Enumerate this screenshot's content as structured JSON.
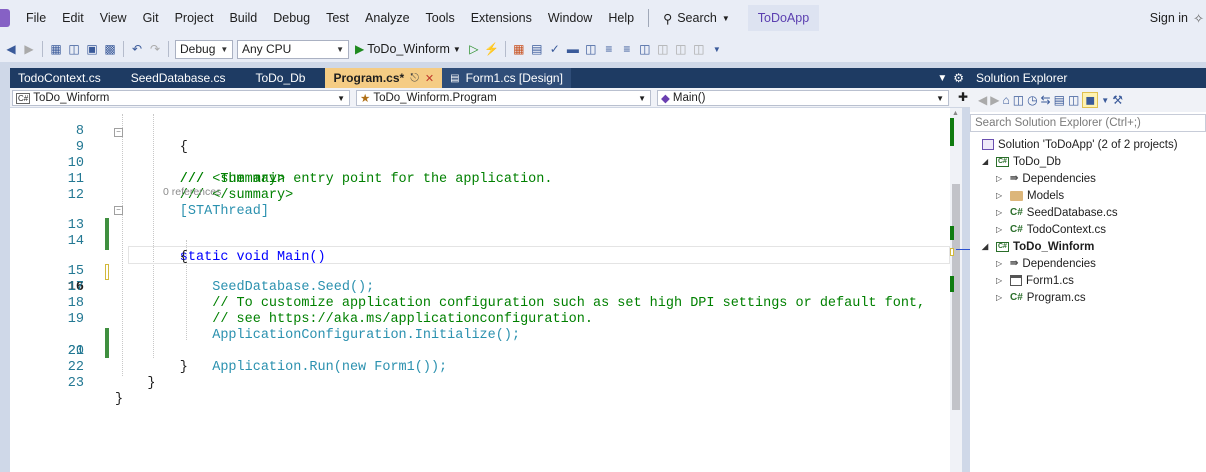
{
  "menubar": {
    "items": [
      "File",
      "Edit",
      "View",
      "Git",
      "Project",
      "Build",
      "Debug",
      "Test",
      "Analyze",
      "Tools",
      "Extensions",
      "Window",
      "Help"
    ],
    "search_label": "Search",
    "app_name": "ToDoApp",
    "sign_in": "Sign in"
  },
  "toolbar": {
    "config": "Debug",
    "platform": "Any CPU",
    "run_target": "ToDo_Winform"
  },
  "tabs": [
    {
      "label": "TodoContext.cs"
    },
    {
      "label": "SeedDatabase.cs"
    },
    {
      "label": "ToDo_Db"
    },
    {
      "label": "Program.cs*"
    },
    {
      "label": "Form1.cs [Design]"
    }
  ],
  "navbar": {
    "project": "ToDo_Winform",
    "type": "ToDo_Winform.Program",
    "member": "Main()"
  },
  "editor": {
    "codelens": "0 references",
    "current_line": "16",
    "lines": [
      {
        "num": "8",
        "text": "        {"
      },
      {
        "num": "9",
        "text": "        /// <summary>"
      },
      {
        "num": "10",
        "text": "        ///  The main entry point for the application."
      },
      {
        "num": "11",
        "text": "        /// </summary>"
      },
      {
        "num": "12",
        "text": "        [STAThread]"
      },
      {
        "num": "13",
        "text": "        static void Main()"
      },
      {
        "num": "14",
        "text": "        {"
      },
      {
        "num": "15",
        "text": "            SeedDatabase.Seed();"
      },
      {
        "num": "16",
        "text": ""
      },
      {
        "num": "17",
        "text": "            // To customize application configuration such as set high DPI settings or default font,"
      },
      {
        "num": "18",
        "text": "            // see https://aka.ms/applicationconfiguration."
      },
      {
        "num": "19",
        "text": "            ApplicationConfiguration.Initialize();"
      },
      {
        "num": "20",
        "text": "            Application.Run(new Form1());"
      },
      {
        "num": "21",
        "text": "        }"
      },
      {
        "num": "22",
        "text": "    }"
      },
      {
        "num": "23",
        "text": "}"
      }
    ]
  },
  "solution_explorer": {
    "title": "Solution Explorer",
    "search_placeholder": "Search Solution Explorer (Ctrl+;)",
    "solution": "Solution 'ToDoApp' (2 of 2 projects)",
    "nodes": [
      {
        "label": "ToDo_Db",
        "icon": "csharp-project-icon"
      },
      {
        "label": "Dependencies",
        "icon": "dependencies-icon"
      },
      {
        "label": "Models",
        "icon": "folder-icon"
      },
      {
        "label": "SeedDatabase.cs",
        "icon": "csharp-file-icon"
      },
      {
        "label": "TodoContext.cs",
        "icon": "csharp-file-icon"
      },
      {
        "label": "ToDo_Winform",
        "icon": "csharp-project-icon"
      },
      {
        "label": "Dependencies",
        "icon": "dependencies-icon"
      },
      {
        "label": "Form1.cs",
        "icon": "form-icon"
      },
      {
        "label": "Program.cs",
        "icon": "csharp-file-icon"
      }
    ]
  }
}
